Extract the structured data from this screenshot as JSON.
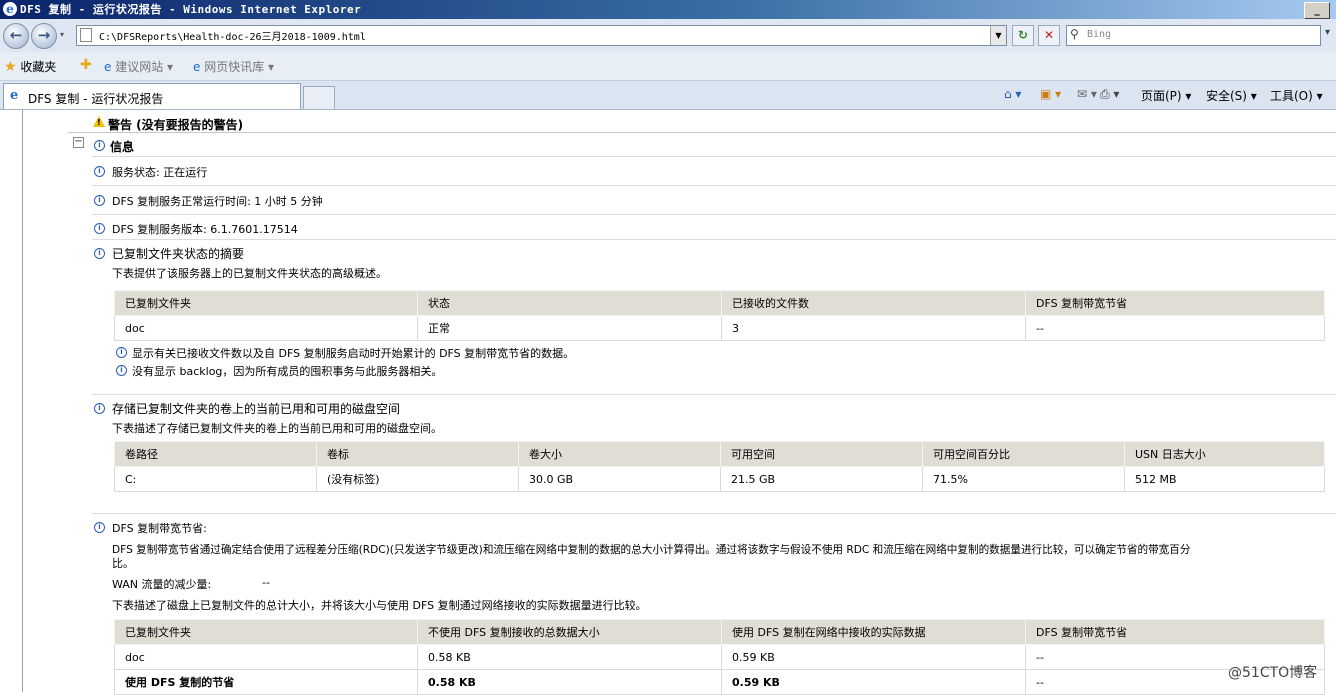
{
  "window": {
    "title": "DFS 复制 - 运行状况报告 - Windows Internet Explorer"
  },
  "address": {
    "url": "C:\\DFSReports\\Health-doc-26三月2018-1009.html",
    "search_placeholder": "Bing"
  },
  "favorites": {
    "favorites_label": "收藏夹",
    "suggested_sites": "建议网站 ▾",
    "web_slice": "网页快讯库 ▾"
  },
  "tab": {
    "label": "DFS 复制 - 运行状况报告"
  },
  "commands": {
    "page": "页面(P) ▾",
    "safety": "安全(S) ▾",
    "tools": "工具(O) ▾"
  },
  "report": {
    "warning_heading": "警告 (没有要报告的警告)",
    "info_heading": "信息",
    "service_status": "服务状态: 正在运行",
    "uptime": "DFS 复制服务正常运行时间: 1 小时 5 分钟",
    "version": "DFS 复制服务版本: 6.1.7601.17514",
    "folder_summary": {
      "title": "已复制文件夹状态的摘要",
      "desc": "下表提供了该服务器上的已复制文件夹状态的高级概述。",
      "headers": [
        "已复制文件夹",
        "状态",
        "已接收的文件数",
        "DFS 复制带宽节省"
      ],
      "rows": [
        [
          "doc",
          "正常",
          "3",
          "--"
        ]
      ],
      "note1": "显示有关已接收文件数以及自 DFS 复制服务启动时开始累计的 DFS 复制带宽节省的数据。",
      "note2": "没有显示 backlog，因为所有成员的囤积事务与此服务器相关。"
    },
    "disk_space": {
      "title": "存储已复制文件夹的卷上的当前已用和可用的磁盘空间",
      "desc": "下表描述了存储已复制文件夹的卷上的当前已用和可用的磁盘空间。",
      "headers": [
        "卷路径",
        "卷标",
        "卷大小",
        "可用空间",
        "可用空间百分比",
        "USN 日志大小"
      ],
      "rows": [
        [
          "C:",
          "(没有标签)",
          "30.0 GB",
          "21.5 GB",
          "71.5%",
          "512 MB"
        ]
      ]
    },
    "bandwidth": {
      "title": "DFS 复制带宽节省:",
      "desc_line1": "DFS 复制带宽节省通过确定结合使用了远程差分压缩(RDC)(只发送字节级更改)和流压缩在网络中复制的数据的总大小计算得出。通过将该数字与假设不使用 RDC 和流压缩在网络中复制的数据量进行比较，可以确定节省的带宽百分",
      "desc_line2": "比。",
      "wan_label": "WAN 流量的减少量:",
      "wan_value": "--",
      "desc2": "下表描述了磁盘上已复制文件的总计大小，并将该大小与使用 DFS 复制通过网络接收的实际数据量进行比较。",
      "headers": [
        "已复制文件夹",
        "不使用 DFS 复制接收的总数据大小",
        "使用 DFS 复制在网络中接收的实际数据",
        "DFS 复制带宽节省"
      ],
      "rows": [
        [
          "doc",
          "0.58 KB",
          "0.59 KB",
          "--"
        ]
      ],
      "total_row": [
        "使用 DFS 复制的节省",
        "0.58 KB",
        "0.59 KB",
        "--"
      ]
    }
  },
  "watermark": "@51CTO博客"
}
